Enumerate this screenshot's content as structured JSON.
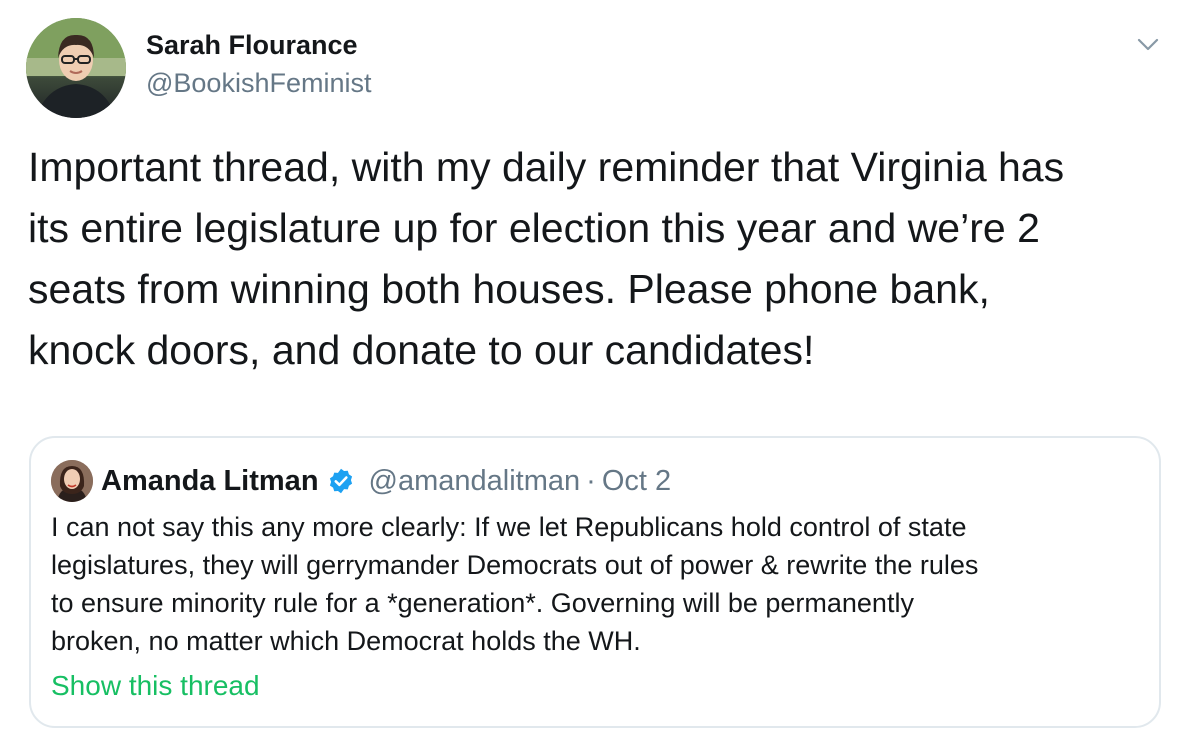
{
  "author": {
    "name": "Sarah Flourance",
    "handle": "@BookishFeminist",
    "avatar_icon": "user-photo-avatar"
  },
  "menu": {
    "icon": "chevron-down-icon"
  },
  "tweet": {
    "lines": [
      "Important thread, with my daily reminder that Virginia has",
      "its entire legislature up for election this year and we’re 2",
      "seats from winning both houses. Please phone bank,",
      "knock doors, and donate to our candidates!"
    ]
  },
  "quote": {
    "name": "Amanda Litman",
    "verified": true,
    "handle": "@amandalitman",
    "separator": "·",
    "date": "Oct 2",
    "lines": [
      "I can not say this any more clearly: If we let Republicans hold control of state",
      "legislatures, they will gerrymander Democrats out of power & rewrite the rules",
      "to ensure minority rule for a *generation*. Governing will be permanently",
      "broken, no matter which Democrat holds the WH."
    ],
    "show_thread": "Show this thread"
  },
  "colors": {
    "verified_badge": "#1da1f2",
    "link_green": "#17bf63",
    "secondary_text": "#657786",
    "border": "#e1e8ed"
  }
}
